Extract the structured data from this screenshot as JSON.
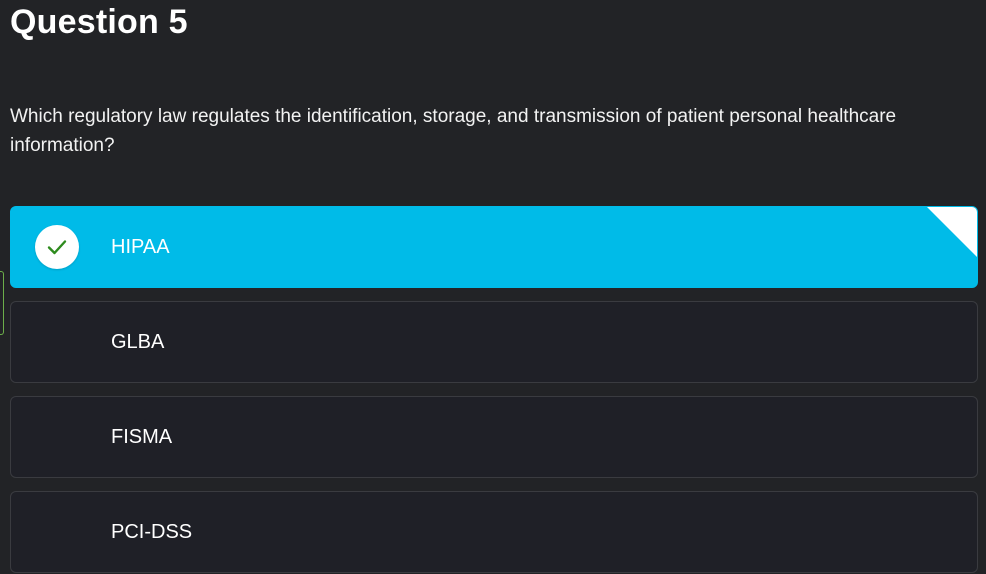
{
  "question": {
    "title": "Question 5",
    "text": "Which regulatory law regulates the identification, storage, and transmission of patient personal healthcare information?"
  },
  "options": [
    {
      "label": "HIPAA",
      "selected": true
    },
    {
      "label": "GLBA",
      "selected": false
    },
    {
      "label": "FISMA",
      "selected": false
    },
    {
      "label": "PCI-DSS",
      "selected": false
    }
  ],
  "colors": {
    "background": "#222326",
    "selected": "#00bbe8",
    "option": "#1f2027",
    "check": "#2e8b1e"
  },
  "icons": {
    "selected_mark": "check-icon"
  }
}
